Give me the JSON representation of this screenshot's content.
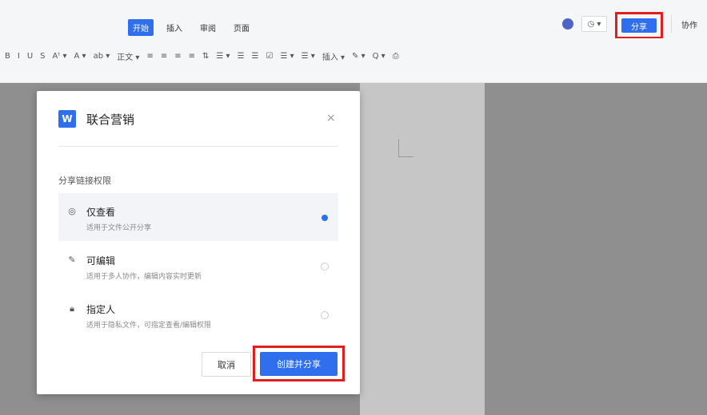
{
  "menu": {
    "tabs": [
      {
        "label": "开始",
        "active": true
      },
      {
        "label": "插入",
        "active": false
      },
      {
        "label": "审阅",
        "active": false
      },
      {
        "label": "页面",
        "active": false
      }
    ]
  },
  "header_right": {
    "history_label": "◷ ▾",
    "share_label": "分享",
    "collab_label": "协作"
  },
  "toolbar": {
    "items": [
      "B",
      "I",
      "U",
      "S",
      "Aᵗ ▾",
      "A ▾",
      "ab ▾",
      "正文 ▾",
      "≡",
      "≡",
      "≡",
      "≡",
      "⇅",
      "☰ ▾",
      "☰",
      "☰",
      "☑",
      "☰ ▾",
      "☰ ▾",
      "插入 ▾",
      "✎ ▾",
      "Q ▾",
      "⎙"
    ]
  },
  "modal": {
    "logo": "W",
    "title": "联合营销",
    "close_symbol": "×",
    "section_label": "分享链接权限",
    "options": [
      {
        "title": "仅查看",
        "desc": "适用于文件公开分享",
        "icon": "eye-icon",
        "selected": true
      },
      {
        "title": "可编辑",
        "desc": "适用于多人协作，编辑内容实时更新",
        "icon": "pencil-icon",
        "selected": false
      },
      {
        "title": "指定人",
        "desc": "适用于隐私文件，可指定查看/编辑权限",
        "icon": "lock-icon",
        "selected": false
      }
    ],
    "cancel_label": "取消",
    "confirm_label": "创建并分享"
  },
  "colors": {
    "accent": "#2f6fed",
    "highlight_box": "#e31c1c"
  }
}
